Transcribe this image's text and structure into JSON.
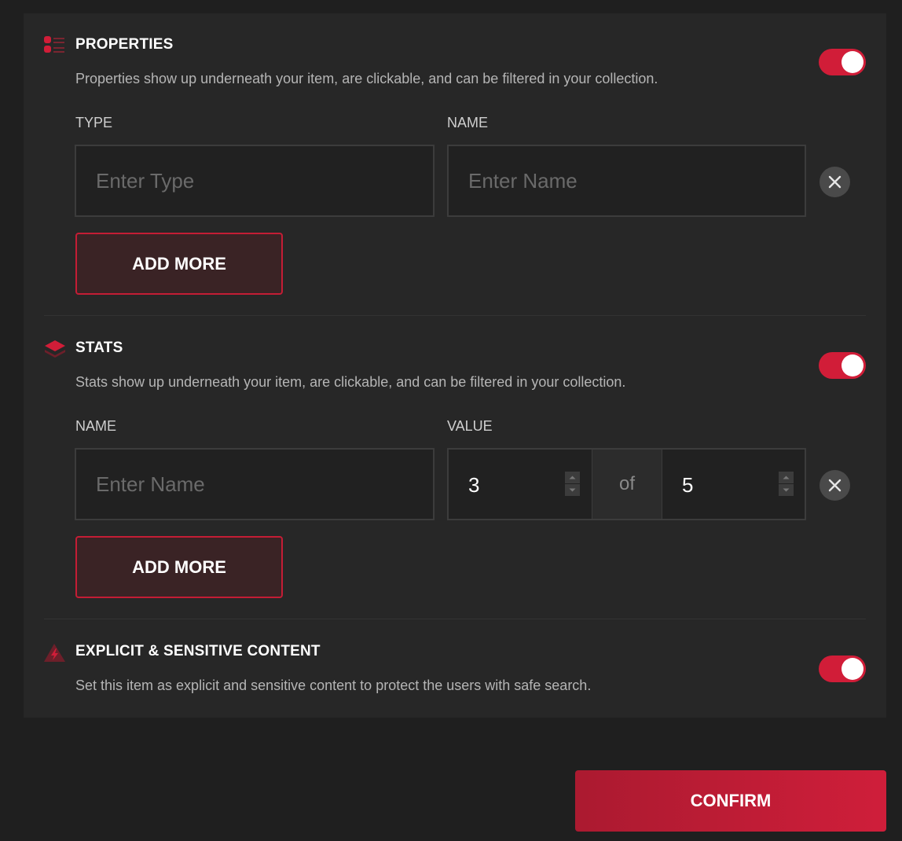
{
  "properties": {
    "icon": "list-icon",
    "title": "PROPERTIES",
    "description": "Properties show up underneath your item, are clickable, and can be filtered in your collection.",
    "enabled": true,
    "type_label": "TYPE",
    "name_label": "NAME",
    "type_placeholder": "Enter Type",
    "name_placeholder": "Enter Name",
    "add_more_label": "ADD MORE"
  },
  "stats": {
    "icon": "layers-icon",
    "title": "STATS",
    "description": "Stats show up underneath your item, are clickable, and can be filtered in your collection.",
    "enabled": true,
    "name_label": "NAME",
    "value_label": "VALUE",
    "name_placeholder": "Enter Name",
    "value": "3",
    "of_label": "of",
    "max": "5",
    "add_more_label": "ADD MORE"
  },
  "explicit": {
    "icon": "warning-bolt-icon",
    "title": "EXPLICIT & SENSITIVE CONTENT",
    "description": "Set this item as explicit and sensitive content to protect the users with safe search.",
    "enabled": true
  },
  "confirm_label": "CONFIRM",
  "colors": {
    "accent": "#d11d38",
    "background": "#1f1f1f",
    "panel": "#272727"
  }
}
